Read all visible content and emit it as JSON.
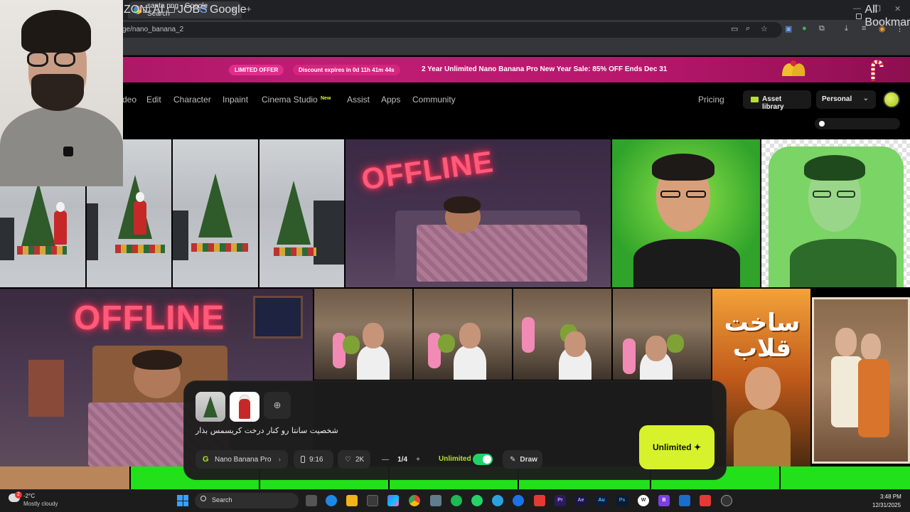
{
  "browser": {
    "tab_title": "santa png - Google Search",
    "new_tab": "+",
    "tab_close": "×",
    "url": "ge/nano_banana_2",
    "bookmarks": [
      "ZON",
      "AI",
      "JOBS",
      "Google"
    ],
    "all_bookmarks": "All Bookmarks",
    "window_controls": [
      "—",
      "❐",
      "✕"
    ]
  },
  "promo": {
    "badge": "LIMITED OFFER",
    "discount": "Discount expires in 0d 11h 41m 44s",
    "text": "2 Year Unlimited Nano Banana Pro New Year Sale: 85% OFF Ends Dec 31"
  },
  "nav": {
    "items": [
      "deo",
      "Edit",
      "Character",
      "Inpaint",
      "Cinema Studio",
      "Assist",
      "Apps",
      "Community"
    ],
    "new_badge": "New",
    "pricing": "Pricing",
    "asset_library": "Asset library",
    "workspace": "Personal"
  },
  "gallery": {
    "neon_sign": "OFFLINE",
    "poster_title": "ساخت قلاب"
  },
  "prompt": {
    "text": "شخصیت سانتا رو کنار درخت کریسمس بذار",
    "model": "Nano Banana Pro",
    "aspect_ratio": "9:16",
    "likes": "2K",
    "count_minus": "—",
    "count": "1/4",
    "count_plus": "+",
    "unlimited_label": "Unlimited",
    "unlimited_on": true,
    "draw": "Draw",
    "generate": "Unlimited ✦"
  },
  "taskbar": {
    "weather_temp": "-2°C",
    "weather_desc": "Mostly cloudy",
    "weather_badge": "2",
    "search": "Search",
    "time": "3:48 PM",
    "date": "12/31/2025"
  },
  "icons": {
    "neon_color": "#ff5a7a",
    "accent": "#d7f22b",
    "toggle_on": "#1ed36a"
  }
}
